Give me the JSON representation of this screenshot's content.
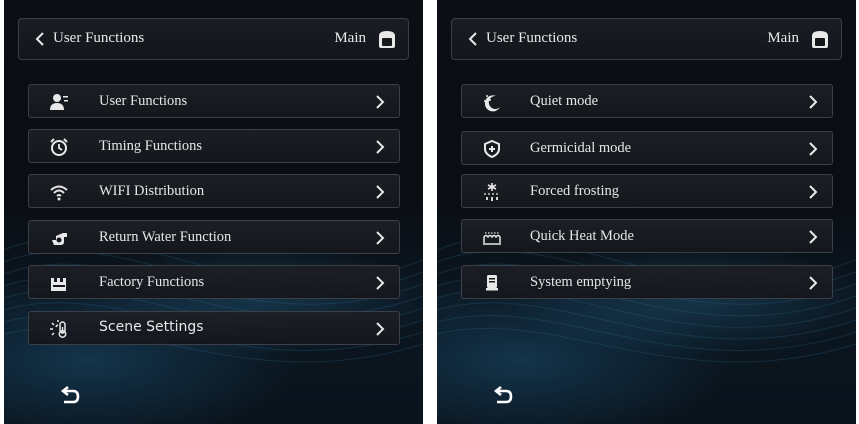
{
  "left_panel": {
    "header": {
      "title": "User Functions",
      "main_label": "Main"
    },
    "items": [
      {
        "label": "User Functions",
        "icon": "user-list-icon"
      },
      {
        "label": "Timing Functions",
        "icon": "alarm-clock-icon"
      },
      {
        "label": "WIFI Distribution",
        "icon": "wifi-icon"
      },
      {
        "label": "Return Water Function",
        "icon": "water-pump-icon"
      },
      {
        "label": "Factory Functions",
        "icon": "factory-icon"
      },
      {
        "label": "Scene Settings",
        "icon": "thermometer-sun-icon"
      }
    ]
  },
  "right_panel": {
    "header": {
      "title": "User Functions",
      "main_label": "Main"
    },
    "items": [
      {
        "label": "Quiet mode",
        "icon": "moon-stars-icon"
      },
      {
        "label": "Germicidal mode",
        "icon": "shield-plus-icon"
      },
      {
        "label": "Forced frosting",
        "icon": "snowflake-drop-icon"
      },
      {
        "label": "Quick Heat Mode",
        "icon": "heating-coil-icon"
      },
      {
        "label": "System emptying",
        "icon": "tank-drain-icon"
      }
    ]
  },
  "colors": {
    "background": "#0b0e13",
    "accent": "#2a6a90",
    "text": "#e6e6e6",
    "border": "#3b4048"
  }
}
